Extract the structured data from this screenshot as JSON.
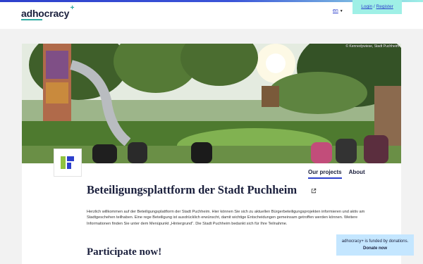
{
  "header": {
    "logo_text": "adhocracy",
    "logo_plus": "+",
    "language": "en",
    "login_label": "Login",
    "separator": " / ",
    "register_label": "Register"
  },
  "hero": {
    "credit": "© Kennedywiese, Stadt Puchheim"
  },
  "tabs": [
    {
      "label": "Our projects",
      "active": true
    },
    {
      "label": "About",
      "active": false
    }
  ],
  "organisation": {
    "title": "Beteiligungsplattform der Stadt Puchheim",
    "intro": "Herzlich willkommen auf der Beteiligungsplattform der Stadt Puchheim. Hier können Sie sich zu aktuellen Bürgerbeteiligungsprojekten informieren und aktiv am Stadtgeschehen teilhaben. Eine rege Beteiligung ist ausdrücklich erwünscht, damit wichtige Entscheidungen gemeinsam getroffen werden können. Weitere Informationen finden Sie unter dem Menüpunkt „Hintergrund“. Die Stadt Puchheim bedankt sich für Ihre Teilnahme."
  },
  "participate_heading": "Participate now!",
  "donation": {
    "text": "adhocracy+ is funded by donations.",
    "link": "Donate now"
  },
  "colors": {
    "accent": "#2d40cc",
    "mint": "#9ff0e6",
    "donation_bg": "#c4e6ff",
    "logo_blue": "#2d40cc",
    "logo_green": "#8fc23f"
  }
}
